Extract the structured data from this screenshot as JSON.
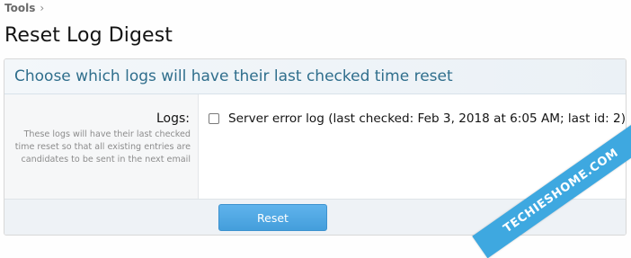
{
  "breadcrumb": {
    "item": "Tools",
    "separator": "›"
  },
  "page": {
    "title": "Reset Log Digest"
  },
  "block": {
    "header": "Choose which logs will have their last checked time reset",
    "form": {
      "label": "Logs:",
      "explain": "These logs will have their last checked time reset so that all existing entries are candidates to be sent in the next email",
      "option": {
        "label": "Server error log (last checked: Feb 3, 2018 at 6:05 AM; last id: 2)",
        "checked": false
      }
    },
    "submit_label": "Reset"
  },
  "watermark": {
    "text": "TECHIESHOME.COM"
  },
  "colors": {
    "accent": "#47a7eb",
    "header_text": "#2f6e8c",
    "watermark": "#3ea8e0"
  }
}
